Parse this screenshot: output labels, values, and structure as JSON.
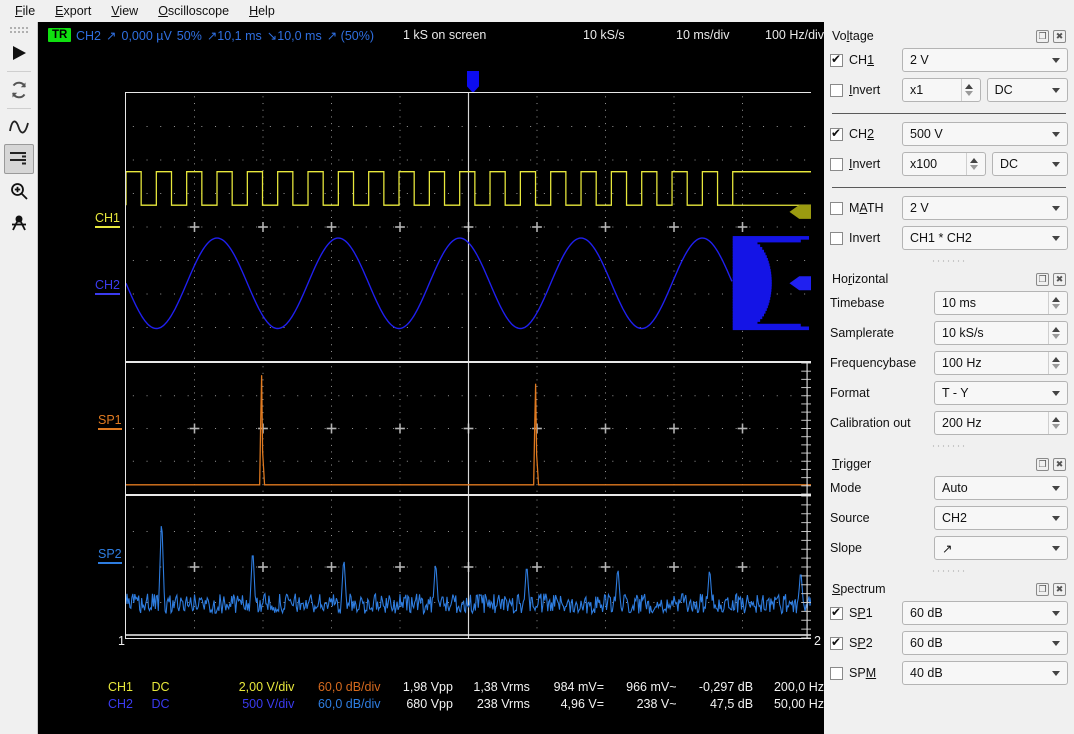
{
  "menu": {
    "items": [
      {
        "pre": "",
        "key": "F",
        "post": "ile"
      },
      {
        "pre": "",
        "key": "E",
        "post": "xport"
      },
      {
        "pre": "",
        "key": "V",
        "post": "iew"
      },
      {
        "pre": "",
        "key": "O",
        "post": "scilloscope"
      },
      {
        "pre": "",
        "key": "H",
        "post": "elp"
      }
    ]
  },
  "toolbar": {
    "items": [
      {
        "name": "run-button",
        "icon": "play-icon"
      },
      {
        "name": "refresh-button",
        "icon": "refresh-icon"
      },
      {
        "name": "waveform-button",
        "icon": "waveform-icon"
      },
      {
        "name": "spectrum-button",
        "icon": "spectrum-icon"
      },
      {
        "name": "zoom-button",
        "icon": "magnifier-icon"
      },
      {
        "name": "measure-button",
        "icon": "calipers-icon"
      }
    ]
  },
  "status": {
    "trigger_badge": "TR",
    "trigger_source": "CH2",
    "trigger_slope": "↗",
    "trigger_level": "0,000 µV",
    "trigger_pos": "50%",
    "hold_rise": "↗10,1 ms",
    "hold_fall": "↘10,0 ms",
    "hold_tail": "↗ (50%)",
    "samples_on_screen": "1 kS on screen",
    "samplerate": "10 kS/s",
    "timediv": "10 ms/div",
    "freqdiv": "100 Hz/div"
  },
  "plot_labels": {
    "ch1": "CH1",
    "ch2": "CH2",
    "sp1": "SP1",
    "sp2": "SP2",
    "axis_left": "1",
    "axis_right": "2"
  },
  "readout": {
    "headers": [
      "channel",
      "coupling",
      "voltsdiv",
      "dbdiv",
      "vpp",
      "vrms",
      "dc",
      "ac",
      "db",
      "freq"
    ],
    "rows": [
      {
        "channel": "CH1",
        "coupling": "DC",
        "voltsdiv": "2,00 V/div",
        "dbdiv": "60,0 dB/div",
        "vpp": "1,98 Vpp",
        "vrms": "1,38 Vrms",
        "dc": "984 mV=",
        "ac": "966 mV~",
        "db": "-0,297 dB",
        "freq": "200,0 Hz"
      },
      {
        "channel": "CH2",
        "coupling": "DC",
        "voltsdiv": "500 V/div",
        "dbdiv": "60,0 dB/div",
        "vpp": "680 Vpp",
        "vrms": "238 Vrms",
        "dc": "4,96 V=",
        "ac": "238 V~",
        "db": "47,5 dB",
        "freq": "50,00 Hz"
      }
    ]
  },
  "dock": {
    "voltage": {
      "title_pre": "Vo",
      "title_key": "l",
      "title_post": "tage",
      "ch1": {
        "label_pre": "CH",
        "label_key": "1",
        "checked": true,
        "range": "2 V",
        "invert_label_pre": "",
        "invert_key": "I",
        "invert_post": "nvert",
        "invert_checked": false,
        "probe": "x1",
        "coupling": "DC"
      },
      "ch2": {
        "label_pre": "CH",
        "label_key": "2",
        "checked": true,
        "range": "500 V",
        "invert_label_pre": "",
        "invert_key": "I",
        "invert_post": "nvert",
        "invert_checked": false,
        "probe": "x100",
        "coupling": "DC"
      },
      "math": {
        "label_pre": "M",
        "label_key": "A",
        "label_post": "TH",
        "checked": false,
        "range": "2 V",
        "invert_label": "Invert",
        "invert_checked": false,
        "expression": "CH1 * CH2"
      }
    },
    "horizontal": {
      "title_pre": "Ho",
      "title_key": "r",
      "title_post": "izontal",
      "fields": [
        {
          "label": "Timebase",
          "value": "10 ms",
          "kind": "spin"
        },
        {
          "label": "Samplerate",
          "value": "10 kS/s",
          "kind": "spin"
        },
        {
          "label": "Frequencybase",
          "value": "100 Hz",
          "kind": "spin"
        },
        {
          "label": "Format",
          "value": "T - Y",
          "kind": "combo"
        },
        {
          "label": "Calibration out",
          "value": "200 Hz",
          "kind": "spin"
        }
      ]
    },
    "trigger": {
      "title_pre": "",
      "title_key": "T",
      "title_post": "rigger",
      "fields": [
        {
          "label": "Mode",
          "value": "Auto"
        },
        {
          "label": "Source",
          "value": "CH2"
        },
        {
          "label": "Slope",
          "value": "↗"
        }
      ]
    },
    "spectrum": {
      "title_pre": "",
      "title_key": "S",
      "title_post": "pectrum",
      "rows": [
        {
          "label_pre": "S",
          "label_key": "P",
          "label_post": "1",
          "checked": true,
          "value": "60 dB"
        },
        {
          "label_pre": "S",
          "label_key": "P",
          "label_post": "2",
          "checked": true,
          "value": "60 dB"
        },
        {
          "label_pre": "SP",
          "label_key": "M",
          "label_post": "",
          "checked": false,
          "value": "40 dB"
        }
      ]
    },
    "icons": {
      "float": "❐",
      "close": "✖"
    }
  },
  "chart_data": {
    "type": "line",
    "panes": [
      {
        "name": "waveform",
        "grid": {
          "cols": 10,
          "rows": 8,
          "dotted": true
        },
        "series": [
          {
            "name": "CH1",
            "color": "#e8e83c",
            "shape": "square",
            "cycles": 20,
            "amplitude_div": 0.5,
            "offset_div": -1.15,
            "duty": 0.5,
            "units": "2,00 V/div",
            "vpp": 1.98
          },
          {
            "name": "CH2",
            "color": "#2020f0",
            "shape": "sine",
            "cycles": 5,
            "amplitude_div": 1.35,
            "offset_div": 0.72,
            "units": "500 V/div",
            "vpp": 680
          }
        ],
        "markers": [
          {
            "name": "ch1-level-arrow",
            "color": "#9a9a10",
            "y_div": -0.45
          },
          {
            "name": "ch2-level-arrow",
            "color": "#2020f0",
            "y_div": 0.72
          }
        ]
      },
      {
        "name": "spectrum-1",
        "grid": {
          "cols": 10,
          "rows": 4,
          "dotted": true
        },
        "series": [
          {
            "name": "SP1",
            "color": "#e07a20",
            "shape": "peaks",
            "baseline_frac": 0.93,
            "peaks": [
              {
                "x_frac": 0.198,
                "h_frac": 0.9
              },
              {
                "x_frac": 0.598,
                "h_frac": 0.83
              }
            ],
            "units": "60 dB"
          }
        ]
      },
      {
        "name": "spectrum-2",
        "grid": {
          "cols": 10,
          "rows": 4,
          "dotted": true
        },
        "series": [
          {
            "name": "SP2",
            "color": "#2e7de0",
            "shape": "noise-peaks",
            "noise_floor_frac": 0.8,
            "noise_amp_frac": 0.07,
            "peaks": [
              {
                "x_frac": 0.052,
                "h_frac": 0.84
              },
              {
                "x_frac": 0.185,
                "h_frac": 0.56
              },
              {
                "x_frac": 0.318,
                "h_frac": 0.48
              },
              {
                "x_frac": 0.452,
                "h_frac": 0.44
              },
              {
                "x_frac": 0.585,
                "h_frac": 0.42
              },
              {
                "x_frac": 0.718,
                "h_frac": 0.39
              },
              {
                "x_frac": 0.852,
                "h_frac": 0.38
              },
              {
                "x_frac": 0.985,
                "h_frac": 0.36
              }
            ],
            "units": "60 dB"
          }
        ]
      }
    ],
    "xlabel": "",
    "ylabel": "",
    "x_ticks": [
      "1",
      "2"
    ]
  }
}
